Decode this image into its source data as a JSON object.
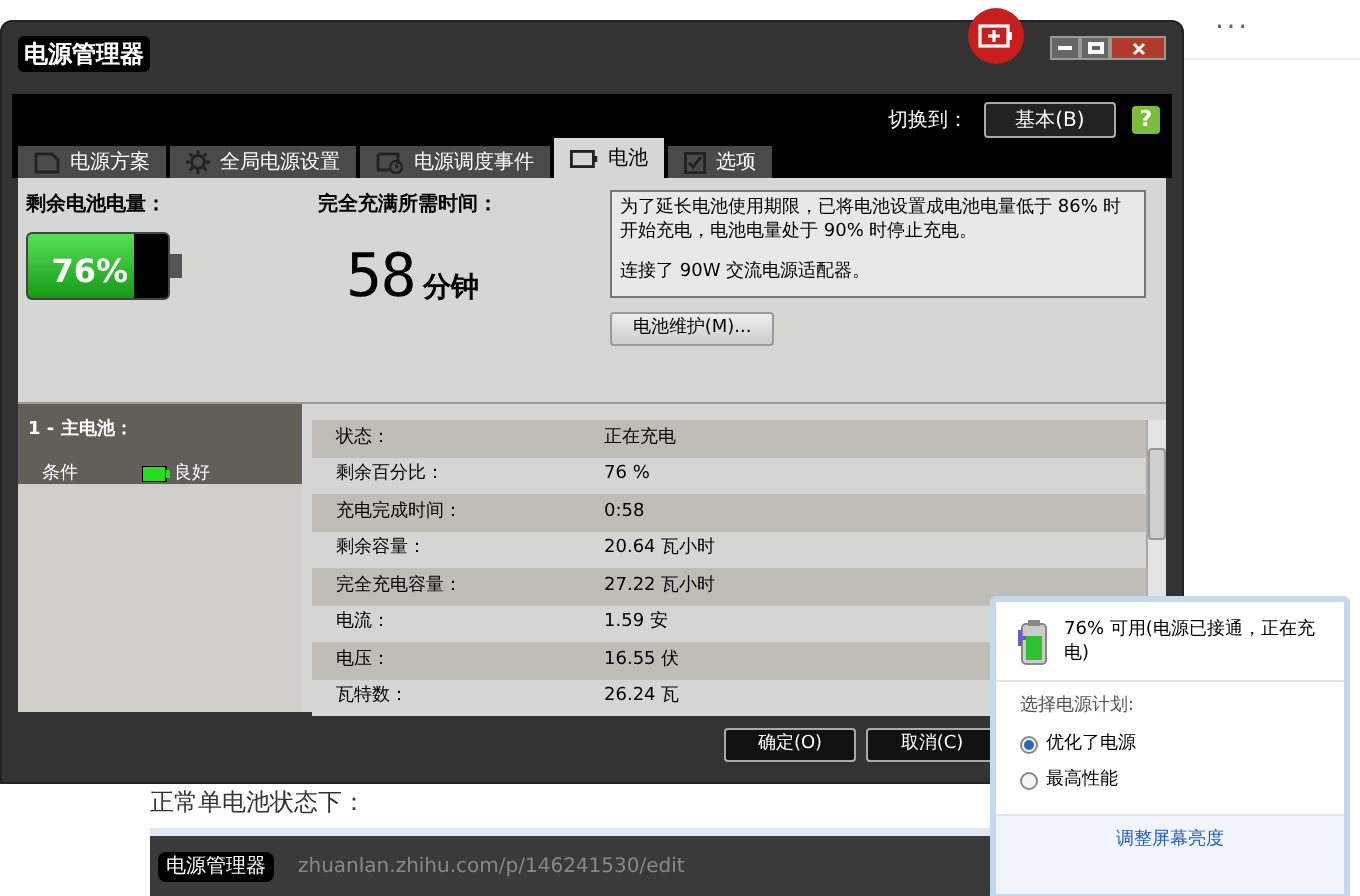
{
  "editor": {
    "more": "···",
    "paragraph": "正常单电池状态下：",
    "embedded_screenshot": {
      "title": "电源管理器",
      "url": "zhuanlan.zhihu.com/p/146241530/edit"
    }
  },
  "window": {
    "title": "电源管理器",
    "switch_label": "切换到：",
    "switch_button": "基本(B)",
    "help": "?",
    "tabs": [
      {
        "label": "电源方案",
        "selected": false
      },
      {
        "label": "全局电源设置",
        "selected": false
      },
      {
        "label": "电源调度事件",
        "selected": false
      },
      {
        "label": "电池",
        "selected": true
      },
      {
        "label": "选项",
        "selected": false
      }
    ],
    "remaining_label": "剩余电池电量：",
    "battery": {
      "level": 0.76,
      "reading": "76%"
    },
    "time_label": "完全充满所需时间：",
    "time_value": "58",
    "time_unit": "分钟",
    "info": [
      "为了延长电池使用期限，已将电池设置成电池电量低于 86% 时开始充电，电池电量处于 90% 时停止充电。",
      "连接了 90W 交流电源适配器。"
    ],
    "maintenance_button": "电池维护(M)...",
    "battery_list": {
      "title": "1 - 主电池：",
      "condition_label": "条件",
      "condition": "良好"
    },
    "details": [
      {
        "label": "状态：",
        "value": "正在充电"
      },
      {
        "label": "剩余百分比：",
        "value": "76 %"
      },
      {
        "label": "充电完成时间：",
        "value": "0:58"
      },
      {
        "label": "剩余容量：",
        "value": "20.64 瓦小时"
      },
      {
        "label": "完全充电容量：",
        "value": "27.22 瓦小时"
      },
      {
        "label": "电流：",
        "value": "1.59 安"
      },
      {
        "label": "电压：",
        "value": "16.55 伏"
      },
      {
        "label": "瓦特数：",
        "value": "26.24 瓦"
      }
    ],
    "buttons": [
      "确定(O)",
      "取消(C)"
    ]
  },
  "popup": {
    "status": "76% 可用(电源已接通，正在充电)",
    "plan_label": "选择电源计划:",
    "plans": [
      {
        "label": "优化了电源",
        "selected": true
      },
      {
        "label": "最高性能",
        "selected": false
      }
    ],
    "link": "调整屏幕亮度"
  }
}
